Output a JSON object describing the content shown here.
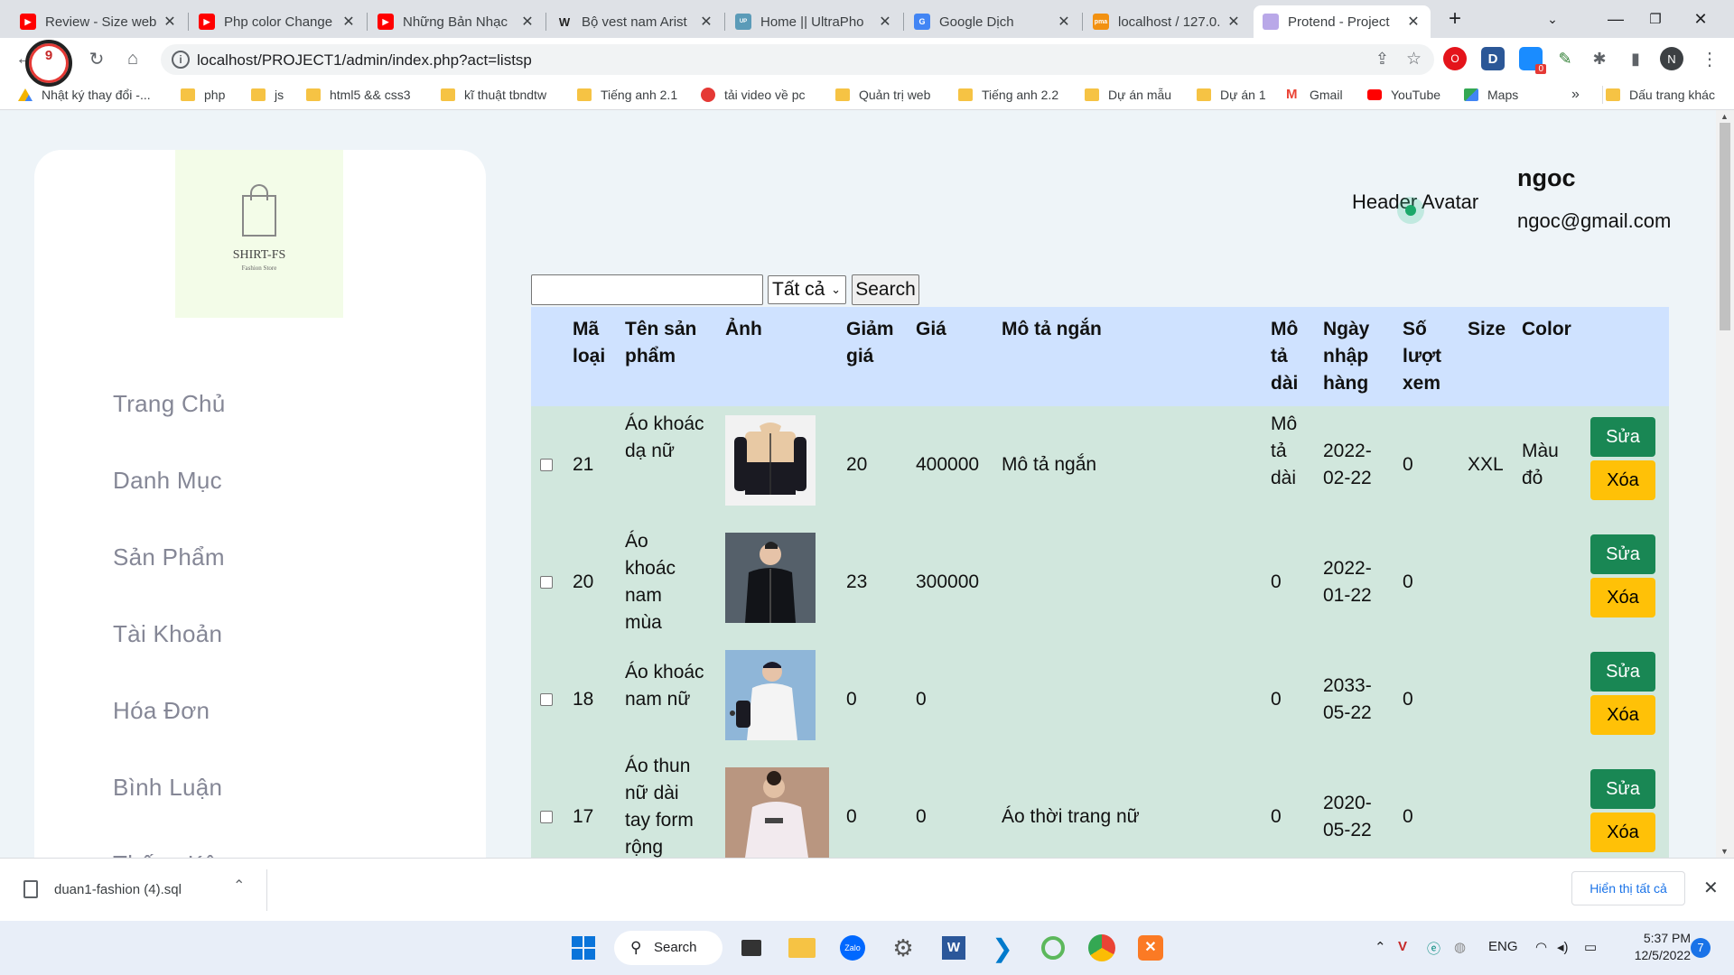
{
  "browser": {
    "tabs": [
      {
        "title": "Review - Size web",
        "favicon": "youtube-icon",
        "active": false
      },
      {
        "title": "Php color Change",
        "favicon": "youtube-icon",
        "active": false
      },
      {
        "title": "Những Bản Nhạc",
        "favicon": "youtube-icon",
        "active": false
      },
      {
        "title": "Bộ vest nam Arist",
        "favicon": "brand-icon",
        "active": false
      },
      {
        "title": "Home || UltraPho",
        "favicon": "ultraphone-icon",
        "active": false
      },
      {
        "title": "Google Dịch",
        "favicon": "google-translate-icon",
        "active": false
      },
      {
        "title": "localhost / 127.0.",
        "favicon": "phpmyadmin-icon",
        "active": false
      },
      {
        "title": "Protend - Project",
        "favicon": "page-icon",
        "active": true
      }
    ],
    "url": "localhost/PROJECT1/admin/index.php?act=listsp",
    "profile_initial": "N",
    "bookmarks": [
      {
        "label": "Nhật ký thay đổi -...",
        "icon": "google-drive-icon"
      },
      {
        "label": "php",
        "icon": "folder-icon"
      },
      {
        "label": "js",
        "icon": "folder-icon"
      },
      {
        "label": "html5 && css3",
        "icon": "folder-icon"
      },
      {
        "label": "kĩ thuật tbndtw",
        "icon": "folder-icon"
      },
      {
        "label": "Tiếng anh 2.1",
        "icon": "folder-icon"
      },
      {
        "label": "tải video về pc",
        "icon": "4k-icon"
      },
      {
        "label": "Quản trị web",
        "icon": "folder-icon"
      },
      {
        "label": "Tiếng anh 2.2",
        "icon": "folder-icon"
      },
      {
        "label": "Dự án mẫu",
        "icon": "folder-icon"
      },
      {
        "label": "Dự án 1",
        "icon": "folder-icon"
      },
      {
        "label": "Gmail",
        "icon": "gmail-icon"
      },
      {
        "label": "YouTube",
        "icon": "youtube-icon"
      },
      {
        "label": "Maps",
        "icon": "maps-icon"
      }
    ],
    "more_bookmarks": "»",
    "other_bookmarks": "Dấu trang khác"
  },
  "sidebar": {
    "logo_name": "SHIRT-FS",
    "logo_sub": "Fashion Store",
    "menu": [
      "Trang Chủ",
      "Danh Mục",
      "Sản Phẩm",
      "Tài Khoản",
      "Hóa Đơn",
      "Bình Luận",
      "Thống Kê"
    ]
  },
  "header": {
    "avatar_alt": "Header Avatar",
    "user_name": "ngoc",
    "user_email": "ngoc@gmail.com"
  },
  "search": {
    "value": "",
    "filter_selected": "Tất cả",
    "button_label": "Search"
  },
  "table": {
    "columns": [
      "Mã loại",
      "Tên sản phẩm",
      "Ảnh",
      "Giảm giá",
      "Giá",
      "Mô tả ngắn",
      "Mô tả dài",
      "Ngày nhập hàng",
      "Số lượt xem",
      "Size",
      "Color"
    ],
    "rows": [
      {
        "id": "21",
        "name": "Áo khoác dạ nữ",
        "discount": "20",
        "price": "400000",
        "short_desc": "Mô tả ngắn",
        "long_desc": "Mô tả dài",
        "date": "2022-02-22",
        "views": "0",
        "size": "XXL",
        "color": "Màu đỏ"
      },
      {
        "id": "20",
        "name": "Áo khoác nam mùa",
        "discount": "23",
        "price": "300000",
        "short_desc": "",
        "long_desc": "0",
        "date": "2022-01-22",
        "views": "0",
        "size": "",
        "color": ""
      },
      {
        "id": "18",
        "name": "Áo khoác nam nữ",
        "discount": "0",
        "price": "0",
        "short_desc": "",
        "long_desc": "0",
        "date": "2033-05-22",
        "views": "0",
        "size": "",
        "color": ""
      },
      {
        "id": "17",
        "name": "Áo thun nữ dài tay form rộng",
        "discount": "0",
        "price": "0",
        "short_desc": "Áo thời trang nữ",
        "long_desc": "0",
        "date": "2020-05-22",
        "views": "0",
        "size": "",
        "color": ""
      }
    ],
    "edit_label": "Sửa",
    "delete_label": "Xóa"
  },
  "download_bar": {
    "file": "duan1-fashion (4).sql",
    "show_all": "Hiển thị tất cả",
    "badge_count": "9"
  },
  "taskbar": {
    "search_label": "Search",
    "language": "ENG",
    "time": "5:37 PM",
    "date": "12/5/2022",
    "notifications": "7",
    "extension_badge": "0"
  },
  "colors": {
    "table_header_bg": "#cfe2ff",
    "table_row_bg": "#d1e7dd",
    "edit_button": "#198754",
    "delete_button": "#ffc107",
    "page_bg": "#eef4f8"
  }
}
